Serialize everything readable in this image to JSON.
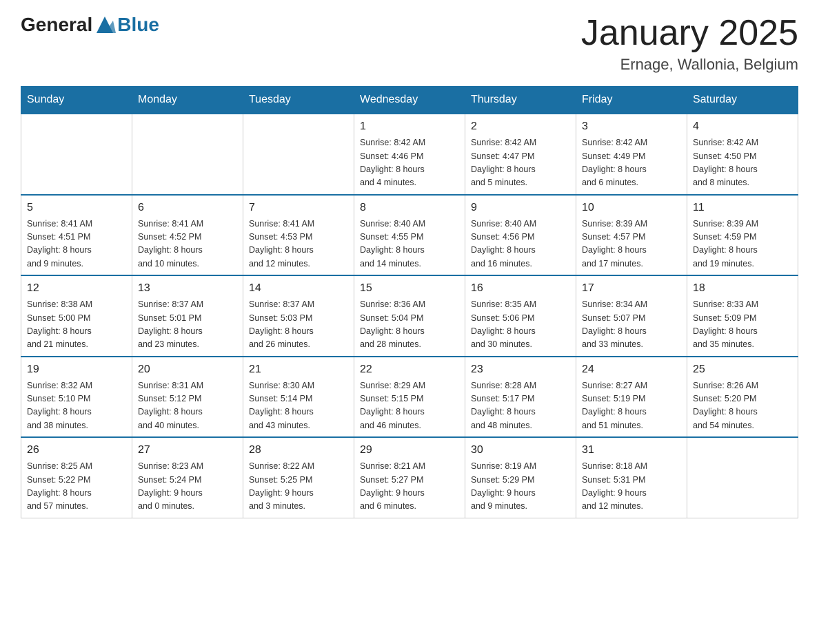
{
  "header": {
    "logo": {
      "general": "General",
      "blue": "Blue"
    },
    "title": "January 2025",
    "subtitle": "Ernage, Wallonia, Belgium"
  },
  "weekdays": [
    "Sunday",
    "Monday",
    "Tuesday",
    "Wednesday",
    "Thursday",
    "Friday",
    "Saturday"
  ],
  "weeks": [
    [
      {
        "day": "",
        "info": ""
      },
      {
        "day": "",
        "info": ""
      },
      {
        "day": "",
        "info": ""
      },
      {
        "day": "1",
        "info": "Sunrise: 8:42 AM\nSunset: 4:46 PM\nDaylight: 8 hours\nand 4 minutes."
      },
      {
        "day": "2",
        "info": "Sunrise: 8:42 AM\nSunset: 4:47 PM\nDaylight: 8 hours\nand 5 minutes."
      },
      {
        "day": "3",
        "info": "Sunrise: 8:42 AM\nSunset: 4:49 PM\nDaylight: 8 hours\nand 6 minutes."
      },
      {
        "day": "4",
        "info": "Sunrise: 8:42 AM\nSunset: 4:50 PM\nDaylight: 8 hours\nand 8 minutes."
      }
    ],
    [
      {
        "day": "5",
        "info": "Sunrise: 8:41 AM\nSunset: 4:51 PM\nDaylight: 8 hours\nand 9 minutes."
      },
      {
        "day": "6",
        "info": "Sunrise: 8:41 AM\nSunset: 4:52 PM\nDaylight: 8 hours\nand 10 minutes."
      },
      {
        "day": "7",
        "info": "Sunrise: 8:41 AM\nSunset: 4:53 PM\nDaylight: 8 hours\nand 12 minutes."
      },
      {
        "day": "8",
        "info": "Sunrise: 8:40 AM\nSunset: 4:55 PM\nDaylight: 8 hours\nand 14 minutes."
      },
      {
        "day": "9",
        "info": "Sunrise: 8:40 AM\nSunset: 4:56 PM\nDaylight: 8 hours\nand 16 minutes."
      },
      {
        "day": "10",
        "info": "Sunrise: 8:39 AM\nSunset: 4:57 PM\nDaylight: 8 hours\nand 17 minutes."
      },
      {
        "day": "11",
        "info": "Sunrise: 8:39 AM\nSunset: 4:59 PM\nDaylight: 8 hours\nand 19 minutes."
      }
    ],
    [
      {
        "day": "12",
        "info": "Sunrise: 8:38 AM\nSunset: 5:00 PM\nDaylight: 8 hours\nand 21 minutes."
      },
      {
        "day": "13",
        "info": "Sunrise: 8:37 AM\nSunset: 5:01 PM\nDaylight: 8 hours\nand 23 minutes."
      },
      {
        "day": "14",
        "info": "Sunrise: 8:37 AM\nSunset: 5:03 PM\nDaylight: 8 hours\nand 26 minutes."
      },
      {
        "day": "15",
        "info": "Sunrise: 8:36 AM\nSunset: 5:04 PM\nDaylight: 8 hours\nand 28 minutes."
      },
      {
        "day": "16",
        "info": "Sunrise: 8:35 AM\nSunset: 5:06 PM\nDaylight: 8 hours\nand 30 minutes."
      },
      {
        "day": "17",
        "info": "Sunrise: 8:34 AM\nSunset: 5:07 PM\nDaylight: 8 hours\nand 33 minutes."
      },
      {
        "day": "18",
        "info": "Sunrise: 8:33 AM\nSunset: 5:09 PM\nDaylight: 8 hours\nand 35 minutes."
      }
    ],
    [
      {
        "day": "19",
        "info": "Sunrise: 8:32 AM\nSunset: 5:10 PM\nDaylight: 8 hours\nand 38 minutes."
      },
      {
        "day": "20",
        "info": "Sunrise: 8:31 AM\nSunset: 5:12 PM\nDaylight: 8 hours\nand 40 minutes."
      },
      {
        "day": "21",
        "info": "Sunrise: 8:30 AM\nSunset: 5:14 PM\nDaylight: 8 hours\nand 43 minutes."
      },
      {
        "day": "22",
        "info": "Sunrise: 8:29 AM\nSunset: 5:15 PM\nDaylight: 8 hours\nand 46 minutes."
      },
      {
        "day": "23",
        "info": "Sunrise: 8:28 AM\nSunset: 5:17 PM\nDaylight: 8 hours\nand 48 minutes."
      },
      {
        "day": "24",
        "info": "Sunrise: 8:27 AM\nSunset: 5:19 PM\nDaylight: 8 hours\nand 51 minutes."
      },
      {
        "day": "25",
        "info": "Sunrise: 8:26 AM\nSunset: 5:20 PM\nDaylight: 8 hours\nand 54 minutes."
      }
    ],
    [
      {
        "day": "26",
        "info": "Sunrise: 8:25 AM\nSunset: 5:22 PM\nDaylight: 8 hours\nand 57 minutes."
      },
      {
        "day": "27",
        "info": "Sunrise: 8:23 AM\nSunset: 5:24 PM\nDaylight: 9 hours\nand 0 minutes."
      },
      {
        "day": "28",
        "info": "Sunrise: 8:22 AM\nSunset: 5:25 PM\nDaylight: 9 hours\nand 3 minutes."
      },
      {
        "day": "29",
        "info": "Sunrise: 8:21 AM\nSunset: 5:27 PM\nDaylight: 9 hours\nand 6 minutes."
      },
      {
        "day": "30",
        "info": "Sunrise: 8:19 AM\nSunset: 5:29 PM\nDaylight: 9 hours\nand 9 minutes."
      },
      {
        "day": "31",
        "info": "Sunrise: 8:18 AM\nSunset: 5:31 PM\nDaylight: 9 hours\nand 12 minutes."
      },
      {
        "day": "",
        "info": ""
      }
    ]
  ]
}
